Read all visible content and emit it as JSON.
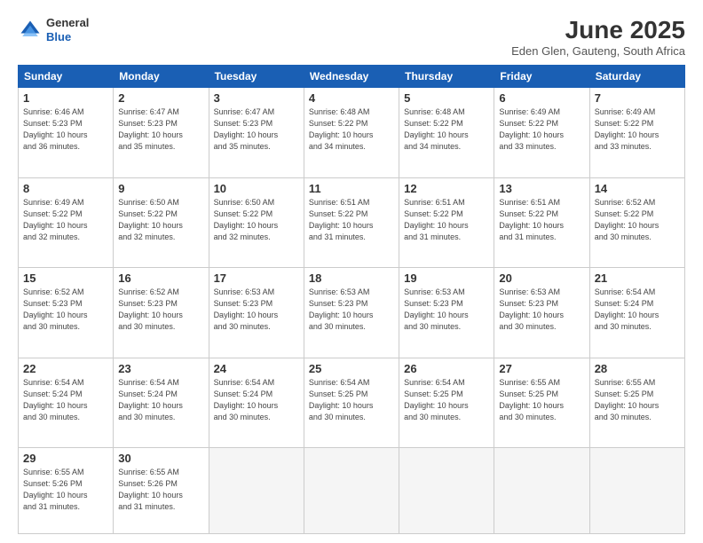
{
  "logo": {
    "general": "General",
    "blue": "Blue"
  },
  "title": {
    "month": "June 2025",
    "location": "Eden Glen, Gauteng, South Africa"
  },
  "weekdays": [
    "Sunday",
    "Monday",
    "Tuesday",
    "Wednesday",
    "Thursday",
    "Friday",
    "Saturday"
  ],
  "weeks": [
    [
      {
        "day": "1",
        "info": "Sunrise: 6:46 AM\nSunset: 5:23 PM\nDaylight: 10 hours\nand 36 minutes."
      },
      {
        "day": "2",
        "info": "Sunrise: 6:47 AM\nSunset: 5:23 PM\nDaylight: 10 hours\nand 35 minutes."
      },
      {
        "day": "3",
        "info": "Sunrise: 6:47 AM\nSunset: 5:23 PM\nDaylight: 10 hours\nand 35 minutes."
      },
      {
        "day": "4",
        "info": "Sunrise: 6:48 AM\nSunset: 5:22 PM\nDaylight: 10 hours\nand 34 minutes."
      },
      {
        "day": "5",
        "info": "Sunrise: 6:48 AM\nSunset: 5:22 PM\nDaylight: 10 hours\nand 34 minutes."
      },
      {
        "day": "6",
        "info": "Sunrise: 6:49 AM\nSunset: 5:22 PM\nDaylight: 10 hours\nand 33 minutes."
      },
      {
        "day": "7",
        "info": "Sunrise: 6:49 AM\nSunset: 5:22 PM\nDaylight: 10 hours\nand 33 minutes."
      }
    ],
    [
      {
        "day": "8",
        "info": "Sunrise: 6:49 AM\nSunset: 5:22 PM\nDaylight: 10 hours\nand 32 minutes."
      },
      {
        "day": "9",
        "info": "Sunrise: 6:50 AM\nSunset: 5:22 PM\nDaylight: 10 hours\nand 32 minutes."
      },
      {
        "day": "10",
        "info": "Sunrise: 6:50 AM\nSunset: 5:22 PM\nDaylight: 10 hours\nand 32 minutes."
      },
      {
        "day": "11",
        "info": "Sunrise: 6:51 AM\nSunset: 5:22 PM\nDaylight: 10 hours\nand 31 minutes."
      },
      {
        "day": "12",
        "info": "Sunrise: 6:51 AM\nSunset: 5:22 PM\nDaylight: 10 hours\nand 31 minutes."
      },
      {
        "day": "13",
        "info": "Sunrise: 6:51 AM\nSunset: 5:22 PM\nDaylight: 10 hours\nand 31 minutes."
      },
      {
        "day": "14",
        "info": "Sunrise: 6:52 AM\nSunset: 5:22 PM\nDaylight: 10 hours\nand 30 minutes."
      }
    ],
    [
      {
        "day": "15",
        "info": "Sunrise: 6:52 AM\nSunset: 5:23 PM\nDaylight: 10 hours\nand 30 minutes."
      },
      {
        "day": "16",
        "info": "Sunrise: 6:52 AM\nSunset: 5:23 PM\nDaylight: 10 hours\nand 30 minutes."
      },
      {
        "day": "17",
        "info": "Sunrise: 6:53 AM\nSunset: 5:23 PM\nDaylight: 10 hours\nand 30 minutes."
      },
      {
        "day": "18",
        "info": "Sunrise: 6:53 AM\nSunset: 5:23 PM\nDaylight: 10 hours\nand 30 minutes."
      },
      {
        "day": "19",
        "info": "Sunrise: 6:53 AM\nSunset: 5:23 PM\nDaylight: 10 hours\nand 30 minutes."
      },
      {
        "day": "20",
        "info": "Sunrise: 6:53 AM\nSunset: 5:23 PM\nDaylight: 10 hours\nand 30 minutes."
      },
      {
        "day": "21",
        "info": "Sunrise: 6:54 AM\nSunset: 5:24 PM\nDaylight: 10 hours\nand 30 minutes."
      }
    ],
    [
      {
        "day": "22",
        "info": "Sunrise: 6:54 AM\nSunset: 5:24 PM\nDaylight: 10 hours\nand 30 minutes."
      },
      {
        "day": "23",
        "info": "Sunrise: 6:54 AM\nSunset: 5:24 PM\nDaylight: 10 hours\nand 30 minutes."
      },
      {
        "day": "24",
        "info": "Sunrise: 6:54 AM\nSunset: 5:24 PM\nDaylight: 10 hours\nand 30 minutes."
      },
      {
        "day": "25",
        "info": "Sunrise: 6:54 AM\nSunset: 5:25 PM\nDaylight: 10 hours\nand 30 minutes."
      },
      {
        "day": "26",
        "info": "Sunrise: 6:54 AM\nSunset: 5:25 PM\nDaylight: 10 hours\nand 30 minutes."
      },
      {
        "day": "27",
        "info": "Sunrise: 6:55 AM\nSunset: 5:25 PM\nDaylight: 10 hours\nand 30 minutes."
      },
      {
        "day": "28",
        "info": "Sunrise: 6:55 AM\nSunset: 5:25 PM\nDaylight: 10 hours\nand 30 minutes."
      }
    ],
    [
      {
        "day": "29",
        "info": "Sunrise: 6:55 AM\nSunset: 5:26 PM\nDaylight: 10 hours\nand 31 minutes."
      },
      {
        "day": "30",
        "info": "Sunrise: 6:55 AM\nSunset: 5:26 PM\nDaylight: 10 hours\nand 31 minutes."
      },
      {
        "day": "",
        "info": ""
      },
      {
        "day": "",
        "info": ""
      },
      {
        "day": "",
        "info": ""
      },
      {
        "day": "",
        "info": ""
      },
      {
        "day": "",
        "info": ""
      }
    ]
  ]
}
